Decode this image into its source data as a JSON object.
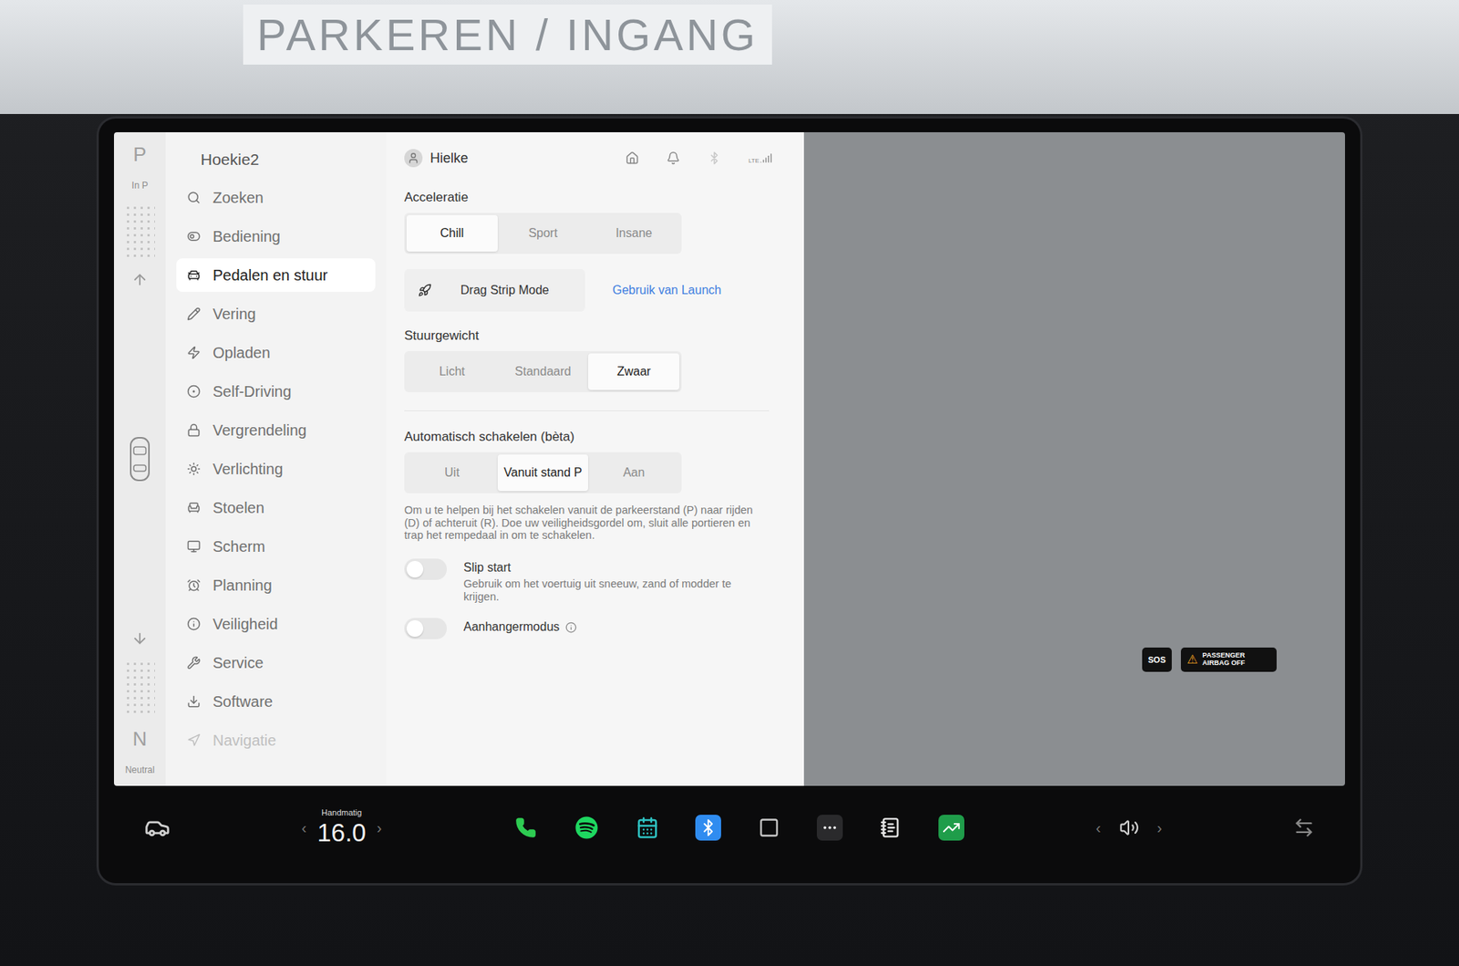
{
  "background_sign": "PARKEREN / INGANG",
  "gear": {
    "top": "P",
    "top_sub": "In P",
    "bottom": "N",
    "bottom_sub": "Neutral"
  },
  "sidebar": {
    "profile": "Hoekie2",
    "items": [
      {
        "label": "Zoeken",
        "selected": false
      },
      {
        "label": "Bediening",
        "selected": false
      },
      {
        "label": "Pedalen en stuur",
        "selected": true
      },
      {
        "label": "Vering",
        "selected": false
      },
      {
        "label": "Opladen",
        "selected": false
      },
      {
        "label": "Self-Driving",
        "selected": false
      },
      {
        "label": "Vergrendeling",
        "selected": false
      },
      {
        "label": "Verlichting",
        "selected": false
      },
      {
        "label": "Stoelen",
        "selected": false
      },
      {
        "label": "Scherm",
        "selected": false
      },
      {
        "label": "Planning",
        "selected": false
      },
      {
        "label": "Veiligheid",
        "selected": false
      },
      {
        "label": "Service",
        "selected": false
      },
      {
        "label": "Software",
        "selected": false
      },
      {
        "label": "Navigatie",
        "selected": false
      }
    ]
  },
  "header": {
    "user": "Hielke",
    "network": "LTE"
  },
  "acceleration": {
    "label": "Acceleratie",
    "options": [
      {
        "label": "Chill",
        "selected": true
      },
      {
        "label": "Sport",
        "selected": false
      },
      {
        "label": "Insane",
        "selected": false
      }
    ]
  },
  "drag_strip": {
    "button": "Drag Strip Mode",
    "link": "Gebruik van Launch"
  },
  "steering": {
    "label": "Stuurgewicht",
    "options": [
      {
        "label": "Licht",
        "selected": false
      },
      {
        "label": "Standaard",
        "selected": false
      },
      {
        "label": "Zwaar",
        "selected": true
      }
    ]
  },
  "auto_shift": {
    "label": "Automatisch schakelen (bèta)",
    "options": [
      {
        "label": "Uit",
        "selected": false
      },
      {
        "label": "Vanuit stand P",
        "selected": true
      },
      {
        "label": "Aan",
        "selected": false
      }
    ],
    "description": "Om u te helpen bij het schakelen vanuit de parkeerstand (P) naar rijden (D) of achteruit (R). Doe uw veiligheidsgordel om, sluit alle portieren en trap het rempedaal in om te schakelen."
  },
  "toggles": [
    {
      "label": "Slip start",
      "on": false,
      "description": "Gebruik om het voertuig uit sneeuw, zand of modder te krijgen."
    },
    {
      "label": "Aanhangermodus",
      "on": false,
      "description": ""
    }
  ],
  "map_badges": {
    "sos": "SOS",
    "airbag": "PASSENGER AIRBAG OFF"
  },
  "taskbar": {
    "climate_mode": "Handmatig",
    "temperature": "16.0",
    "left_arrow": "‹",
    "right_arrow": "›"
  }
}
